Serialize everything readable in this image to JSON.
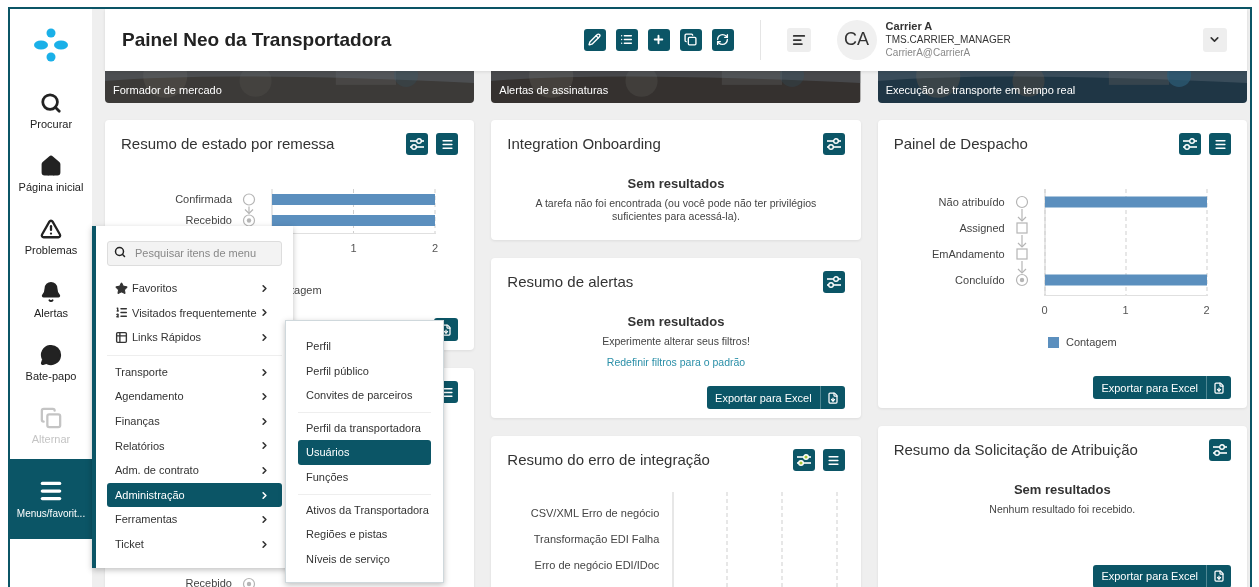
{
  "sidebar": {
    "items": [
      {
        "kind": "search",
        "label": "Procurar",
        "selected": false,
        "disabled": false
      },
      {
        "kind": "home",
        "label": "Página inicial",
        "selected": false,
        "disabled": false
      },
      {
        "kind": "problems",
        "label": "Problemas",
        "selected": false,
        "disabled": false
      },
      {
        "kind": "alerts",
        "label": "Alertas",
        "selected": false,
        "disabled": false
      },
      {
        "kind": "chat",
        "label": "Bate-papo",
        "selected": false,
        "disabled": false
      },
      {
        "kind": "switch",
        "label": "Alternar",
        "selected": false,
        "disabled": true
      },
      {
        "kind": "menu",
        "label": "Menus/favorit...",
        "selected": true,
        "disabled": false
      }
    ]
  },
  "header": {
    "title": "Painel Neo da Transportadora",
    "actions": [
      {
        "kind": "edit"
      },
      {
        "kind": "list"
      },
      {
        "kind": "add"
      },
      {
        "kind": "copy"
      },
      {
        "kind": "refresh"
      }
    ],
    "user": {
      "initials": "CA",
      "name": "Carrier A",
      "role": "TMS.CARRIER_MANAGER",
      "login": "CarrierA@CarrierA"
    }
  },
  "banners": [
    {
      "caption": "Formador de mercado"
    },
    {
      "caption": "Alertas de assinaturas"
    },
    {
      "caption": "Execução de transporte em tempo real"
    }
  ],
  "columns": [
    [
      {
        "title": "Resumo de estado por remessa",
        "buttons": [
          {
            "kind": "filter",
            "active": false
          },
          {
            "kind": "list"
          }
        ],
        "body": {
          "kind": "chart",
          "stages": [
            {
              "kind": "open"
            },
            {
              "kind": "done"
            }
          ],
          "legend_fragment": "tagem",
          "chart_data": {
            "type": "bar",
            "orientation": "horizontal",
            "categories": [
              "Confirmada",
              "Recebido"
            ],
            "series": [
              {
                "color": "#5b8fbe",
                "values": [
                  2,
                  2
                ]
              }
            ],
            "xlim": [
              0,
              2
            ],
            "xticks": [
              1,
              2
            ]
          }
        },
        "export": {
          "kind": "icon"
        }
      },
      {
        "buttons": [
          {
            "kind": "list"
          }
        ],
        "body": {
          "kind": "tail",
          "row_label": "Recebido"
        }
      }
    ],
    [
      {
        "title": "Integration Onboarding",
        "buttons": [
          {
            "kind": "filter",
            "active": false
          }
        ],
        "body": {
          "kind": "empty",
          "heading": "Sem resultados",
          "message": "A tarefa não foi encontrada (ou você pode não ter privilégios suficientes para acessá-la)."
        }
      },
      {
        "title": "Resumo de alertas",
        "buttons": [
          {
            "kind": "filter",
            "active": false
          }
        ],
        "body": {
          "kind": "empty",
          "heading": "Sem resultados",
          "message": "Experimente alterar seus filtros!",
          "link": "Redefinir filtros para o padrão"
        },
        "export": {
          "kind": "full",
          "label": "Exportar para Excel"
        }
      },
      {
        "title": "Resumo do erro de integração",
        "buttons": [
          {
            "kind": "filter",
            "active": true
          },
          {
            "kind": "list"
          }
        ],
        "body": {
          "kind": "labels",
          "row_labels": [
            "CSV/XML Erro de negócio",
            "Transformação EDI Falha",
            "Erro de negócio EDI/IDoc"
          ]
        }
      }
    ],
    [
      {
        "title": "Painel de Despacho",
        "buttons": [
          {
            "kind": "filter",
            "active": false
          },
          {
            "kind": "list"
          }
        ],
        "body": {
          "kind": "chart",
          "stages": [
            {
              "kind": "open"
            },
            {
              "kind": "pending"
            },
            {
              "kind": "pending"
            },
            {
              "kind": "done"
            }
          ],
          "chart_data": {
            "type": "bar",
            "orientation": "horizontal",
            "categories": [
              "Não atribuído",
              "Assigned",
              "EmAndamento",
              "Concluído"
            ],
            "series": [
              {
                "name": "Contagem",
                "color": "#5b8fbe",
                "values": [
                  2,
                  0,
                  0,
                  2
                ]
              }
            ],
            "xlim": [
              0,
              2
            ],
            "xticks": [
              0,
              1,
              2
            ]
          }
        },
        "export": {
          "kind": "full",
          "label": "Exportar para Excel"
        }
      },
      {
        "title": "Resumo da Solicitação de Atribuição",
        "buttons": [
          {
            "kind": "filter",
            "active": false
          }
        ],
        "body": {
          "kind": "empty",
          "heading": "Sem resultados",
          "message": "Nenhum resultado foi recebido."
        },
        "export": {
          "kind": "full",
          "label": "Exportar para Excel"
        }
      }
    ]
  ],
  "menu": {
    "search": {
      "placeholder": "Pesquisar itens de menu"
    },
    "groups": [
      [
        {
          "label": "Favoritos",
          "kind": "star",
          "selected": false
        },
        {
          "label": "Visitados frequentemente",
          "kind": "numbered",
          "selected": false
        },
        {
          "label": "Links Rápidos",
          "kind": "table",
          "selected": false
        }
      ],
      [
        {
          "label": "Transporte",
          "selected": false
        },
        {
          "label": "Agendamento",
          "selected": false
        },
        {
          "label": "Finanças",
          "selected": false
        },
        {
          "label": "Relatórios",
          "selected": false
        },
        {
          "label": "Adm. de contrato",
          "selected": false
        },
        {
          "label": "Administração",
          "selected": true
        },
        {
          "label": "Ferramentas",
          "selected": false
        },
        {
          "label": "Ticket",
          "selected": false
        }
      ]
    ]
  },
  "submenu": {
    "groups": [
      [
        {
          "label": "Perfil",
          "selected": false
        },
        {
          "label": "Perfil público",
          "selected": false
        },
        {
          "label": "Convites de parceiros",
          "selected": false
        }
      ],
      [
        {
          "label": "Perfil da transportadora",
          "selected": false
        },
        {
          "label": "Usuários",
          "selected": true
        },
        {
          "label": "Funções",
          "selected": false
        }
      ],
      [
        {
          "label": "Ativos da Transportadora",
          "selected": false
        },
        {
          "label": "Regiões e pistas",
          "selected": false
        },
        {
          "label": "Níveis de serviço",
          "selected": false
        }
      ]
    ]
  }
}
